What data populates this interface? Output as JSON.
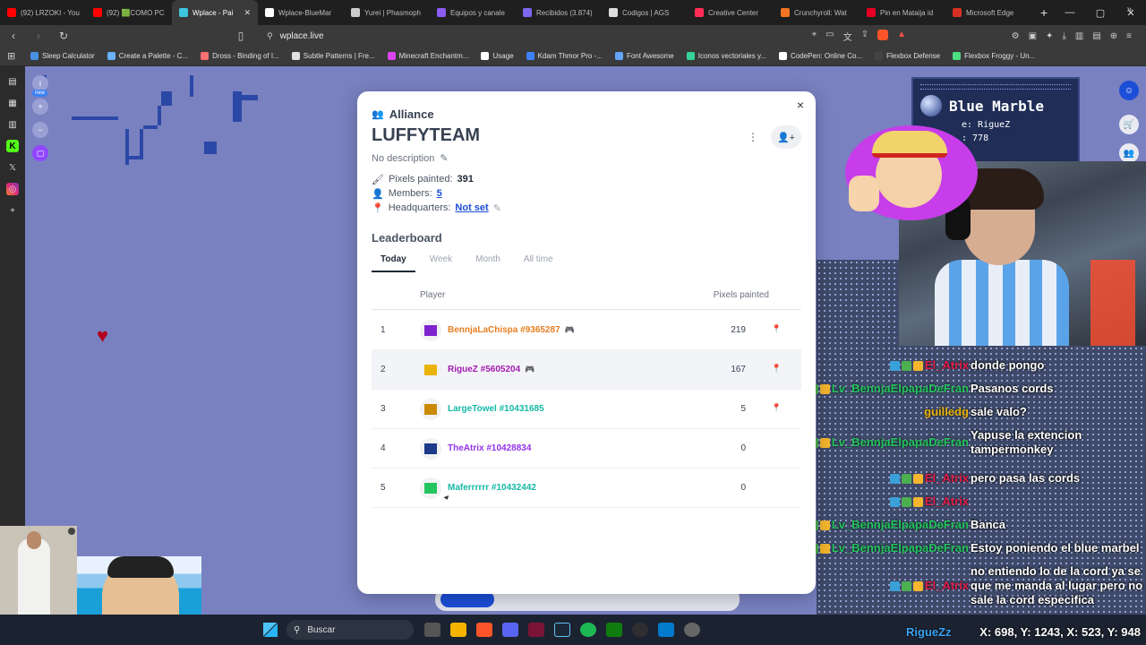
{
  "browser": {
    "tabs": [
      {
        "label": "(92) LRZOKI - You",
        "color": "#ff0000",
        "active": false
      },
      {
        "label": "(92) 🟩COMO PC",
        "color": "#ff0000",
        "active": false
      },
      {
        "label": "Wplace - Pai",
        "color": "#3ec6e0",
        "active": true
      },
      {
        "label": "Wplace-BlueMar",
        "color": "#ffffff",
        "active": false
      },
      {
        "label": "Yurei | Phasmoph",
        "color": "#cccccc",
        "active": false
      },
      {
        "label": "Equipos y canale",
        "color": "#8b5cf6",
        "active": false
      },
      {
        "label": "Recibidos (3.874)",
        "color": "#7b68ee",
        "active": false
      },
      {
        "label": "Codigos | AGS",
        "color": "#dddddd",
        "active": false
      },
      {
        "label": "Creative Center",
        "color": "#ff2d55",
        "active": false
      },
      {
        "label": "Crunchyroll: Wat",
        "color": "#f47521",
        "active": false
      },
      {
        "label": "Pin en Mataija id",
        "color": "#e60023",
        "active": false
      },
      {
        "label": "Microsoft Edge",
        "color": "#d93025",
        "active": false
      }
    ],
    "url": "wplace.live",
    "bookmarks": [
      {
        "label": "Sleep Calculator",
        "color": "#4a90e2"
      },
      {
        "label": "Create a Palette - C...",
        "color": "#6ab0ff"
      },
      {
        "label": "Dross - Binding of I...",
        "color": "#f87171"
      },
      {
        "label": "Subtle Patterns | Fre...",
        "color": "#e0e0e0"
      },
      {
        "label": "Minecraft Enchantm...",
        "color": "#d946ef"
      },
      {
        "label": "Usage",
        "color": "#ffffff"
      },
      {
        "label": "Kdam Thmor Pro -...",
        "color": "#3b82f6"
      },
      {
        "label": "Font Awesome",
        "color": "#60a5fa"
      },
      {
        "label": "Iconos vectoriales y...",
        "color": "#34d399"
      },
      {
        "label": "CodePen: Online Co...",
        "color": "#ffffff"
      },
      {
        "label": "Flexbox Defense",
        "color": "#444444"
      },
      {
        "label": "Flexbox Froggy - Un...",
        "color": "#4ade80"
      }
    ]
  },
  "canvas": {
    "new_badge": "new"
  },
  "blue_marble": {
    "title": "Blue Marble",
    "line1": "e: RigueZ",
    "line2": ": 778"
  },
  "alliance": {
    "header": "Alliance",
    "name": "LUFFYTEAM",
    "description": "No description",
    "stats": {
      "pixels_label": "Pixels painted:",
      "pixels_value": "391",
      "members_label": "Members:",
      "members_value": "5",
      "hq_label": "Headquarters:",
      "hq_value": "Not set"
    },
    "leaderboard_title": "Leaderboard",
    "tabs": [
      "Today",
      "Week",
      "Month",
      "All time"
    ],
    "columns": {
      "player": "Player",
      "pixels": "Pixels painted"
    },
    "rows": [
      {
        "rank": "1",
        "name": "BennjaLaChispa #9365287",
        "color": "#e67e22",
        "avatar": "#7e22ce",
        "count": "219",
        "discord": true,
        "pin": true
      },
      {
        "rank": "2",
        "name": "RigueZ #5605204",
        "color": "#a21caf",
        "avatar": "#eab308",
        "count": "167",
        "discord": true,
        "pin": true
      },
      {
        "rank": "3",
        "name": "LargeTowel #10431685",
        "color": "#14b8a6",
        "avatar": "#ca8a04",
        "count": "5",
        "discord": false,
        "pin": true
      },
      {
        "rank": "4",
        "name": "TheAtrix #10428834",
        "color": "#9333ea",
        "avatar": "#1e3a8a",
        "count": "0",
        "discord": false,
        "pin": false
      },
      {
        "rank": "5",
        "name": "Maferrrrrr #10432442",
        "color": "#14b8a6",
        "avatar": "#22c55e",
        "count": "0",
        "discord": false,
        "pin": false
      }
    ]
  },
  "chat": [
    {
      "user": "El_Atrix",
      "color": "#e11d48",
      "text": "donde pongo"
    },
    {
      "user": "Lv_BennjaElpapaDeFran",
      "color": "#22c55e",
      "text": "Pasanos cords"
    },
    {
      "user": "guilledg",
      "color": "#eab308",
      "text": "sale valo?"
    },
    {
      "user": "Lv_BennjaElpapaDeFran",
      "color": "#22c55e",
      "text": "Yapuse la extencion tampermonkey"
    },
    {
      "user": "El_Atrix",
      "color": "#e11d48",
      "text": "pero pasa las cords"
    },
    {
      "user": "El_Atrix",
      "color": "#e11d48",
      "text": ""
    },
    {
      "user": "Lv_BennjaElpapaDeFran",
      "color": "#22c55e",
      "text": "Banca"
    },
    {
      "user": "Lv_BennjaElpapaDeFran",
      "color": "#22c55e",
      "text": "Estoy poniendo el blue marbel"
    },
    {
      "user": "El_Atrix",
      "color": "#e11d48",
      "text": "no entiendo lo de la cord ya se que me manda al lugar pero no sale la cord especifica"
    }
  ],
  "taskbar": {
    "search_placeholder": "Buscar",
    "overlay_user": "RigueZz",
    "coords": "X: 698, Y: 1243, X: 523, Y: 948"
  }
}
